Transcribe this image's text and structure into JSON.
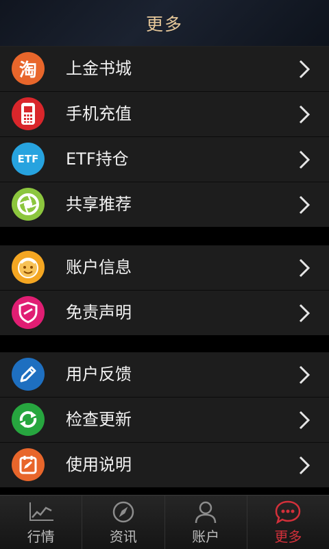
{
  "header": {
    "title": "更多"
  },
  "groups": [
    {
      "items": [
        {
          "label": "上金书城",
          "icon": "taobao-icon",
          "icon_text": "淘",
          "color": "#e8662b"
        },
        {
          "label": "手机充值",
          "icon": "mobile-phone-icon",
          "color": "#d9262b"
        },
        {
          "label": "ETF持仓",
          "icon": "etf-icon",
          "icon_text": "ETF",
          "color": "#27a3df"
        },
        {
          "label": "共享推荐",
          "icon": "aperture-icon",
          "color": "#8cc63e"
        }
      ]
    },
    {
      "items": [
        {
          "label": "账户信息",
          "icon": "smiley-face-icon",
          "color": "#f4a622"
        },
        {
          "label": "免责声明",
          "icon": "shield-icon",
          "color": "#e01e73"
        }
      ]
    },
    {
      "items": [
        {
          "label": "用户反馈",
          "icon": "pencil-icon",
          "color": "#1e6fc0"
        },
        {
          "label": "检查更新",
          "icon": "refresh-icon",
          "color": "#27a63f"
        },
        {
          "label": "使用说明",
          "icon": "notepad-icon",
          "color": "#e8662b"
        }
      ]
    }
  ],
  "tabbar": {
    "tabs": [
      {
        "label": "行情",
        "icon": "chart-line-icon",
        "active": false
      },
      {
        "label": "资讯",
        "icon": "compass-icon",
        "active": false
      },
      {
        "label": "账户",
        "icon": "user-icon",
        "active": false
      },
      {
        "label": "更多",
        "icon": "more-bubble-icon",
        "active": true
      }
    ],
    "active_color": "#d3303a"
  }
}
